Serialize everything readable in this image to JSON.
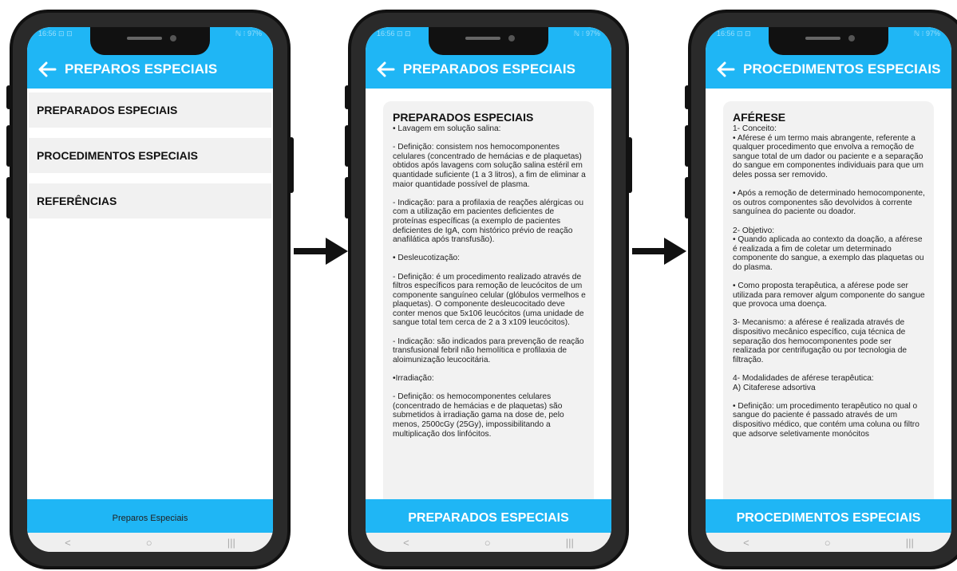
{
  "screens": [
    {
      "appbar_title": "PREPAROS ESPECIAIS",
      "menu_items": [
        "PREPARADOS ESPECIAIS",
        "PROCEDIMENTOS ESPECIAIS",
        "REFERÊNCIAS"
      ],
      "bottom_label": "Preparos Especiais"
    },
    {
      "appbar_title": "PREPARADOS ESPECIAIS",
      "card_title": "PREPARADOS ESPECIAIS",
      "card_text": " • Lavagem em solução salina:\n\n- Definição: consistem nos hemocomponentes celulares (concentrado de hemácias e de plaquetas) obtidos após lavagens com solução salina estéril em quantidade suficiente (1 a 3 litros), a fim de eliminar a maior quantidade possível de plasma.\n\n- Indicação: para a profilaxia de reações alérgicas ou com a utilização em pacientes deficientes de proteínas específicas (a exemplo de pacientes deficientes de IgA, com histórico prévio de reação anafilática após transfusão).\n\n• Desleucotização:\n\n- Definição: é um procedimento realizado através de filtros específicos para remoção de leucócitos de um componente sanguíneo celular (glóbulos vermelhos e plaquetas). O componente desleucocitado deve conter menos que 5x106 leucócitos (uma unidade de sangue total tem cerca de 2 a 3 x109 leucócitos).\n\n- Indicação: são indicados para prevenção de reação transfusional febril não hemolítica e profilaxia de aloimunização leucocitária.\n\n•Irradiação:\n\n- Definição: os hemocomponentes celulares (concentrado de hemácias e de plaquetas) são submetidos à irradiação gama na dose de, pelo menos, 2500cGy (25Gy), impossibilitando a multiplicação dos linfócitos.",
      "bottom_label": "PREPARADOS ESPECIAIS"
    },
    {
      "appbar_title": "PROCEDIMENTOS ESPECIAIS",
      "card_title": "AFÉRESE",
      "card_text": " 1- Conceito:\n• Aférese é um termo mais abrangente, referente a qualquer procedimento que envolva a remoção de sangue total de um dador ou paciente e a separação do sangue em componentes individuais para que um deles possa ser removido.\n\n• Após a remoção de determinado hemocomponente, os outros componentes são devolvidos à corrente sanguínea do paciente ou doador.\n\n2- Objetivo:\n• Quando aplicada ao contexto da doação, a aférese é realizada a fim de coletar um determinado componente do sangue, a exemplo das plaquetas ou do plasma.\n\n• Como proposta terapêutica, a aférese pode ser utilizada para remover algum componente do sangue que provoca uma doença.\n\n3- Mecanismo: a aférese é realizada através de dispositivo mecânico específico, cuja técnica de separação dos hemocomponentes pode ser realizada por centrifugação ou por tecnologia de filtração.\n\n4- Modalidades de aférese terapêutica:\nA) Citaferese adsortiva\n\n• Definição: um procedimento terapêutico no qual o sangue do paciente é passado através de um dispositivo médico, que contém uma coluna ou filtro que adsorve seletivamente monócitos",
      "bottom_label": "PROCEDIMENTOS ESPECIAIS"
    }
  ],
  "status_bar": {
    "left": "16:56 ⊡ ⊡",
    "right": "ℕ ⁝ 97%"
  },
  "nav_bar": {
    "back": "<",
    "home": "○",
    "recents": "|||"
  },
  "colors": {
    "accent": "#1fb6f5",
    "frame": "#111111",
    "card": "#f2f2f2"
  },
  "icons": {
    "back": "arrow-left-icon",
    "flow_arrow": "arrow-right-icon"
  }
}
